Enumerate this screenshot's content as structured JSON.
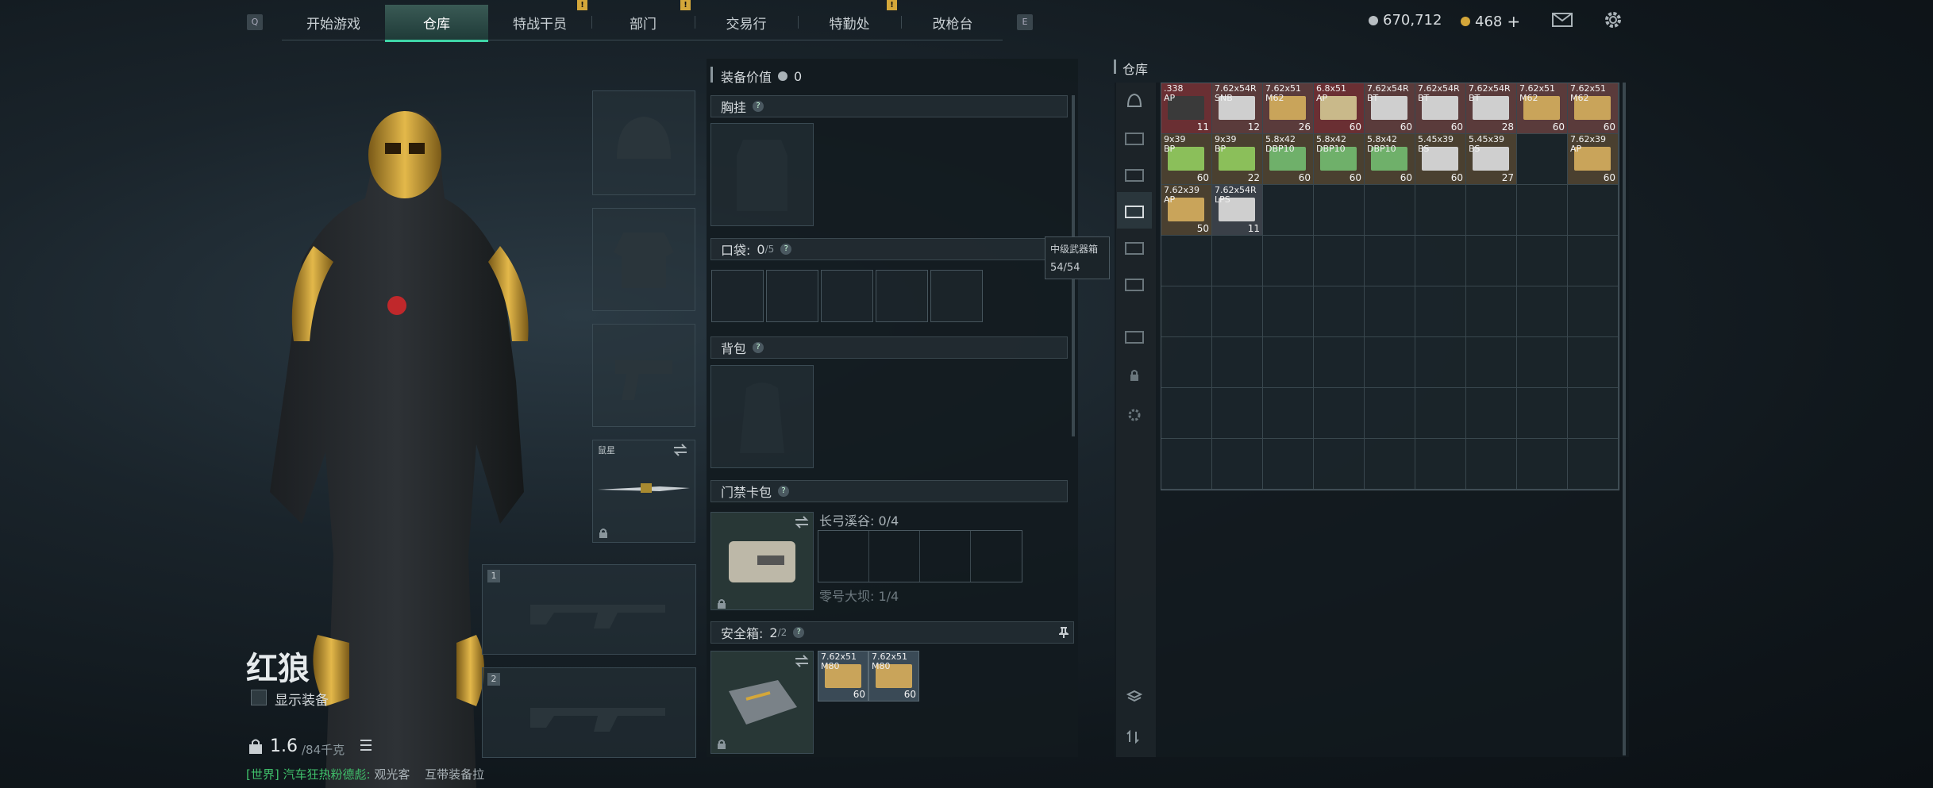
{
  "nav": {
    "left_key": "Q",
    "right_key": "E",
    "tabs": [
      {
        "label": "开始游戏",
        "active": false,
        "notice": false
      },
      {
        "label": "仓库",
        "active": true,
        "notice": false
      },
      {
        "label": "特战干员",
        "active": false,
        "notice": true
      },
      {
        "label": "部门",
        "active": false,
        "notice": false
      },
      {
        "label": "交易行",
        "active": false,
        "notice": true
      },
      {
        "label": "特勤处",
        "active": false,
        "notice": false
      },
      {
        "label": "改枪台",
        "active": false,
        "notice": true
      }
    ],
    "notice_glyph": "!",
    "currency_silver": "670,712",
    "currency_gold": "468",
    "add_symbol": "+"
  },
  "operator": {
    "name": "红狼",
    "show_gear_label": "显示装备",
    "weight": "1.6",
    "weight_max": "/84千克",
    "chat_channel": "[世界]",
    "chat_user": "汽车狂热粉德彪:",
    "chat_text": "观光客",
    "chat_text2": "互带装备拉"
  },
  "equipment": {
    "melee_label": "鼠星",
    "primary_slot_num": "1",
    "secondary_slot_num": "2"
  },
  "loadout": {
    "value_label": "装备价值",
    "value": "0",
    "chest_rig_label": "胸挂",
    "pocket_label": "口袋:",
    "pocket_used": "0",
    "pocket_max": "/5",
    "backpack_label": "背包",
    "keycard_label": "门禁卡包",
    "keycard_zone1": "长弓溪谷: 0/4",
    "keycard_zone2": "零号大坝: 1/4",
    "safebox_label": "安全箱:",
    "safebox_used": "2",
    "safebox_max": "/2",
    "safebox_items": [
      {
        "name": "7.62x51\nM80",
        "count": "60"
      },
      {
        "name": "7.62x51\nM80",
        "count": "60"
      }
    ],
    "help_glyph": "?"
  },
  "tooltip": {
    "title": "中级武器箱",
    "value": "54/54"
  },
  "storage": {
    "title": "仓库",
    "items": [
      {
        "name": ".338\nAP",
        "count": "11",
        "color": "#6a2f33",
        "box": "#3a3a3a"
      },
      {
        "name": "7.62x54R\nSNB",
        "count": "12",
        "color": "#5a3b3b",
        "box": "#cfcfcf"
      },
      {
        "name": "7.62x51\nM62",
        "count": "26",
        "color": "#5a3b3b",
        "box": "#c9a45a"
      },
      {
        "name": "6.8x51\nAP",
        "count": "60",
        "color": "#6a2f33",
        "box": "#c9b98a"
      },
      {
        "name": "7.62x54R\nBT",
        "count": "60",
        "color": "#5a3b3b",
        "box": "#cfcfcf"
      },
      {
        "name": "7.62x54R\nBT",
        "count": "60",
        "color": "#5a3b3b",
        "box": "#cfcfcf"
      },
      {
        "name": "7.62x54R\nBT",
        "count": "28",
        "color": "#5a3b3b",
        "box": "#cfcfcf"
      },
      {
        "name": "7.62x51\nM62",
        "count": "60",
        "color": "#5a3b3b",
        "box": "#c9a45a"
      },
      {
        "name": "7.62x51\nM62",
        "count": "60",
        "color": "#5a3b3b",
        "box": "#c9a45a"
      },
      {
        "name": "9x39\nBP",
        "count": "60",
        "color": "#4a4030",
        "box": "#8bbf5a"
      },
      {
        "name": "9x39\nBP",
        "count": "22",
        "color": "#4a4030",
        "box": "#8bbf5a"
      },
      {
        "name": "5.8x42\nDBP10",
        "count": "60",
        "color": "#4a4030",
        "box": "#6fb06a"
      },
      {
        "name": "5.8x42\nDBP10",
        "count": "60",
        "color": "#4a4030",
        "box": "#6fb06a"
      },
      {
        "name": "5.8x42\nDBP10",
        "count": "60",
        "color": "#4a4030",
        "box": "#6fb06a"
      },
      {
        "name": "5.45x39\nBS",
        "count": "60",
        "color": "#4a4030",
        "box": "#cfcfcf"
      },
      {
        "name": "5.45x39\nBS",
        "count": "27",
        "color": "#4a4030",
        "box": "#cfcfcf"
      },
      null,
      {
        "name": "7.62x39\nAP",
        "count": "60",
        "color": "#4a4030",
        "box": "#c9a45a"
      },
      {
        "name": "7.62x39\nAP",
        "count": "50",
        "color": "#4a4030",
        "box": "#c9a45a"
      },
      {
        "name": "7.62x54R\nLPS",
        "count": "11",
        "color": "#3a4048",
        "box": "#cfcfcf"
      }
    ],
    "total_cells": 72
  },
  "colors": {
    "accent": "#3fd6a8",
    "notice": "#d4a73a",
    "red_tier": "#6a2f33"
  }
}
